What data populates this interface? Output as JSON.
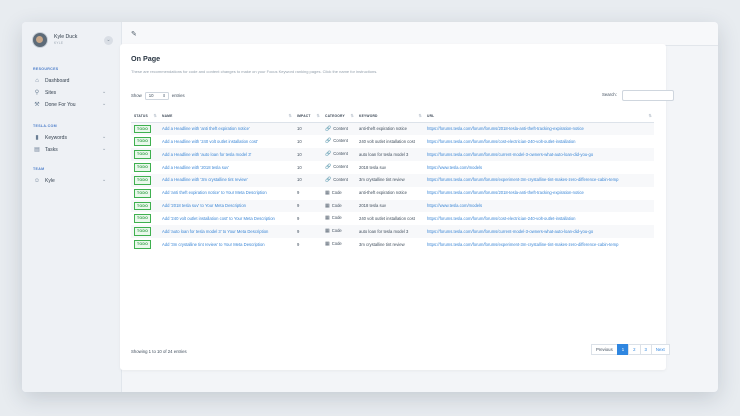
{
  "user": {
    "name": "Kyle Duck",
    "sub": "KYLE",
    "menu_icon": "chevron-down-icon"
  },
  "sidebar": {
    "sections": [
      {
        "label": "RESOURCES",
        "items": [
          {
            "label": "Dashboard",
            "icon": "home-icon",
            "chevron": false
          },
          {
            "label": "Sites",
            "icon": "pin-icon",
            "chevron": true
          },
          {
            "label": "Done For You",
            "icon": "tools-icon",
            "chevron": true
          }
        ]
      },
      {
        "label": "TESLA.COM",
        "items": [
          {
            "label": "Keywords",
            "icon": "bars-icon",
            "chevron": true
          },
          {
            "label": "Tasks",
            "icon": "clipboard-icon",
            "chevron": true
          }
        ]
      },
      {
        "label": "TEAM",
        "items": [
          {
            "label": "Kyle",
            "icon": "user-icon",
            "chevron": true
          }
        ]
      }
    ]
  },
  "page": {
    "title": "On Page",
    "description": "These are recommendations for code and content changes to make on your Focus Keyword ranking pages. Click the name for instructions.",
    "show_label": "Show",
    "show_value": "10",
    "entries_label": "entries",
    "search_label": "Search:",
    "search_placeholder": "",
    "columns": [
      "STATUS",
      "NAME",
      "IMPACT",
      "CATEGORY",
      "KEYWORD",
      "URL"
    ],
    "rows": [
      {
        "status": "TODO",
        "name": "Add a Headline with 'anti theft expiration notice'",
        "impact": "10",
        "category": "Content",
        "keyword": "anti-theft expiration notice",
        "url": "https://forums.tesla.com/forum/forums/2018-tesla-anti-theft-tracking-expiration-notice"
      },
      {
        "status": "TODO",
        "name": "Add a Headline with '240 volt outlet installation cost'",
        "impact": "10",
        "category": "Content",
        "keyword": "240 volt outlet installation cost",
        "url": "https://forums.tesla.com/forum/forums/cost-electrician-240-volt-outlet-installation"
      },
      {
        "status": "TODO",
        "name": "Add a Headline with 'auto loan for tesla model 3'",
        "impact": "10",
        "category": "Content",
        "keyword": "auto loan for tesla model 3",
        "url": "https://forums.tesla.com/forum/forums/current-model-3-owners-what-auto-loan-did-you-go"
      },
      {
        "status": "TODO",
        "name": "Add a Headline with '2018 tesla suv'",
        "impact": "10",
        "category": "Content",
        "keyword": "2018 tesla suv",
        "url": "https://www.tesla.com/models"
      },
      {
        "status": "TODO",
        "name": "Add a Headline with '3m crystalline tint review'",
        "impact": "10",
        "category": "Content",
        "keyword": "3m crystalline tint review",
        "url": "https://forums.tesla.com/forum/forums/experiment-3m-crystalline-tint-makes-zero-difference-cabin-temp"
      },
      {
        "status": "TODO",
        "name": "Add 'anti theft expiration notice' to Your Meta Description",
        "impact": "9",
        "category": "Code",
        "keyword": "anti-theft expiration notice",
        "url": "https://forums.tesla.com/forum/forums/2018-tesla-anti-theft-tracking-expiration-notice"
      },
      {
        "status": "TODO",
        "name": "Add '2018 tesla suv' to Your Meta Description",
        "impact": "9",
        "category": "Code",
        "keyword": "2018 tesla suv",
        "url": "https://www.tesla.com/models"
      },
      {
        "status": "TODO",
        "name": "Add '240 volt outlet installation cost' to Your Meta Description",
        "impact": "9",
        "category": "Code",
        "keyword": "240 volt outlet installation cost",
        "url": "https://forums.tesla.com/forum/forums/cost-electrician-240-volt-outlet-installation"
      },
      {
        "status": "TODO",
        "name": "Add 'auto loan for tesla model 3' to Your Meta Description",
        "impact": "9",
        "category": "Code",
        "keyword": "auto loan for tesla model 3",
        "url": "https://forums.tesla.com/forum/forums/current-model-3-owners-what-auto-loan-did-you-go"
      },
      {
        "status": "TODO",
        "name": "Add '3m crystalline tint review' to Your Meta Description",
        "impact": "9",
        "category": "Code",
        "keyword": "3m crystalline tint review",
        "url": "https://forums.tesla.com/forum/forums/experiment-3m-crystalline-tint-makes-zero-difference-cabin-temp"
      }
    ],
    "footer": "Showing 1 to 10 of 24 entries",
    "pagination": {
      "previous": "Previous",
      "pages": [
        "1",
        "2",
        "3"
      ],
      "current": "1",
      "next": "Next"
    }
  },
  "colors": {
    "accent": "#2f86e0",
    "todo": "#3fb04f"
  }
}
